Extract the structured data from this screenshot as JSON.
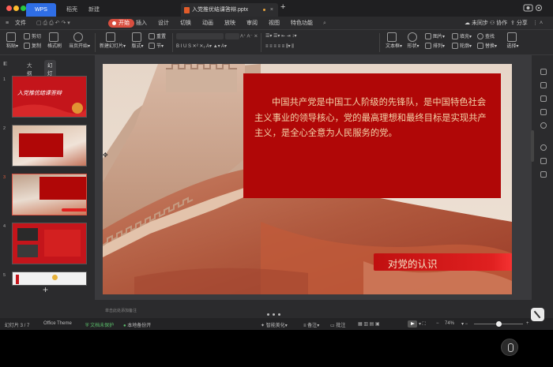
{
  "titlebar": {
    "app_tab": "WPS",
    "home_tab": "稻壳",
    "new_tab": "新建",
    "document_tab": "入党推优结课答辩.pptx",
    "add_tab_icon": "plus-icon"
  },
  "menu": {
    "file": "文件",
    "items": [
      "开始",
      "插入",
      "设计",
      "切换",
      "动画",
      "放映",
      "审阅",
      "视图",
      "特色功能"
    ],
    "right": [
      "未同步",
      "协作",
      "分享"
    ]
  },
  "ribbon": {
    "paste": "粘贴",
    "cut": "剪切",
    "copy": "复制",
    "format_painter": "格式刷",
    "from_current": "当页开始",
    "new_slide": "新建幻灯片",
    "layout": "版式",
    "reset": "重置",
    "section": "节",
    "textbox": "文本框",
    "shape": "形状",
    "picture": "图片",
    "arrange": "排列",
    "fill": "填充",
    "outline": "轮廓",
    "find": "查找",
    "replace": "替换",
    "select": "选择"
  },
  "panel": {
    "outline_tab": "大纲",
    "slides_tab": "幻灯片",
    "slide_numbers": [
      "1",
      "2",
      "3",
      "4",
      "5"
    ],
    "thumb1_title": "入党推优结课答辩",
    "selected_index": 3
  },
  "slide": {
    "body_text": "中国共产党是中国工人阶级的先锋队，是中国特色社会主义事业的领导核心，党的最高理想和最终目标是实现共产主义，是全心全意为人民服务的党。",
    "label": "对党的认识",
    "notes_placeholder": "单击此处添加备注"
  },
  "status": {
    "slide_counter": "幻灯片 3 / 7",
    "theme": "Office Theme",
    "protect": "文档未保护",
    "backup": "本地备份开",
    "smart_beautify": "智能美化",
    "notes": "备注",
    "comments": "批注",
    "zoom": "74%",
    "zoom_fraction": 0.74
  },
  "colors": {
    "accent": "#d84e3f",
    "slide_box": "#b00707",
    "slide_text": "#f3d3a8"
  }
}
